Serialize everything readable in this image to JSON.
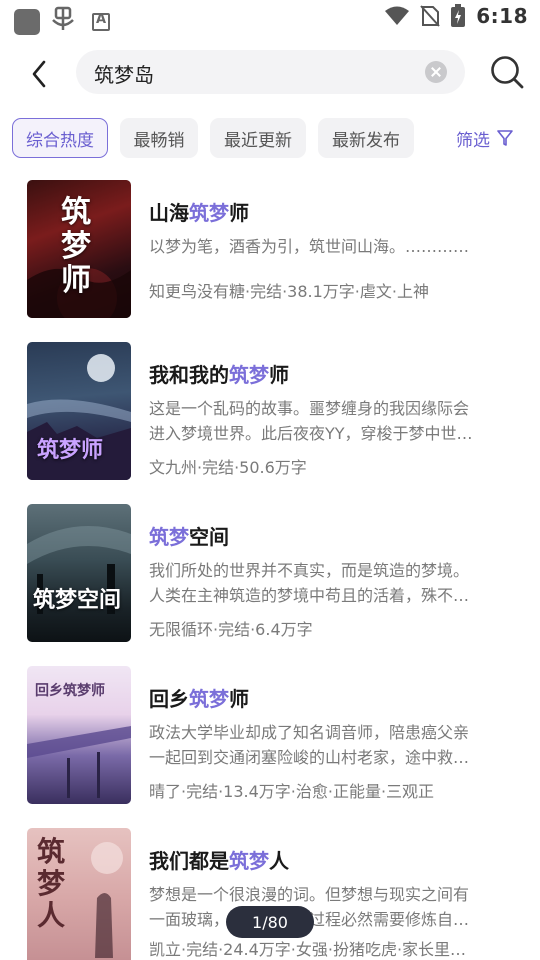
{
  "status_bar": {
    "time": "6:18",
    "icons": [
      "app-square-icon",
      "bug-icon",
      "a-box-icon",
      "wifi-icon",
      "no-sim-icon",
      "battery-charging-icon"
    ]
  },
  "search": {
    "query": "筑梦岛",
    "back_icon": "back-arrow-icon",
    "clear_icon": "clear-icon",
    "search_icon": "search-icon"
  },
  "sort": {
    "tabs": [
      {
        "label": "综合热度",
        "active": true
      },
      {
        "label": "最畅销",
        "active": false
      },
      {
        "label": "最近更新",
        "active": false
      },
      {
        "label": "最新发布",
        "active": false
      }
    ],
    "filter_label": "筛选",
    "filter_icon": "funnel-icon"
  },
  "highlight_color": "#7b6fd9",
  "books": [
    {
      "title_pre": "山海",
      "title_hl": "筑梦",
      "title_post": "师",
      "desc1": "以梦为笔，酒香为引，筑世间山海。…………",
      "desc2": "",
      "meta": "知更鸟没有糖·完结·38.1万字·虐文·上神",
      "cover_text": "筑梦师"
    },
    {
      "title_pre": "我和我的",
      "title_hl": "筑梦",
      "title_post": "师",
      "desc1": "这是一个乱码的故事。噩梦缠身的我因缘际会",
      "desc2": "进入梦境世界。此后夜夜YY，穿梭于梦中世…",
      "meta": "文九州·完结·50.6万字",
      "cover_text": "筑梦师"
    },
    {
      "title_pre": "",
      "title_hl": "筑梦",
      "title_post": "空间",
      "desc1": "我们所处的世界并不真实，而是筑造的梦境。",
      "desc2": "人类在主神筑造的梦境中苟且的活着，殊不…",
      "meta": "无限循环·完结·6.4万字",
      "cover_text": "筑梦空间"
    },
    {
      "title_pre": "回乡",
      "title_hl": "筑梦",
      "title_post": "师",
      "desc1": "政法大学毕业却成了知名调音师，陪患癌父亲",
      "desc2": "一起回到交通闭塞险峻的山村老家，途中救…",
      "meta": "晴了·完结·13.4万字·治愈·正能量·三观正",
      "cover_text": "回乡筑梦师"
    },
    {
      "title_pre": "我们都是",
      "title_hl": "筑梦",
      "title_post": "人",
      "desc1": "梦想是一个很浪漫的词。但梦想与现实之间有",
      "desc2": "一面玻璃，打破这面的过程必然需要修炼自…",
      "meta": "凯立·完结·24.4万字·女强·扮猪吃虎·家长里…",
      "cover_text": "筑梦人"
    }
  ],
  "page_indicator": "1/80"
}
